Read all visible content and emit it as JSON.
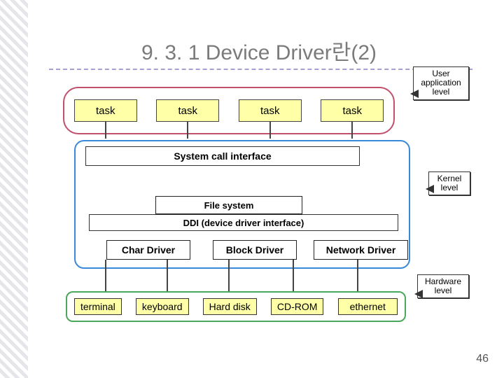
{
  "colors": {
    "task_bg": "#feffa6",
    "hw_bg": "#feffa6",
    "user_border": "#c0516d",
    "kernel_border": "#3a88d8",
    "hw_border": "#4aa85c"
  },
  "title": "9. 3. 1  Device Driver란(2)",
  "callouts": {
    "user": "User application level",
    "kernel": "Kernel level",
    "hardware": "Hardware level"
  },
  "tasks": [
    "task",
    "task",
    "task",
    "task"
  ],
  "sci_title": "System call interface",
  "fs_label": "File system",
  "ddi_label": "DDI (device driver interface)",
  "drivers": {
    "char": "Char Driver",
    "block": "Block Driver",
    "net": "Network Driver"
  },
  "hardware": [
    "terminal",
    "keyboard",
    "Hard disk",
    "CD-ROM",
    "ethernet"
  ],
  "page": "46"
}
